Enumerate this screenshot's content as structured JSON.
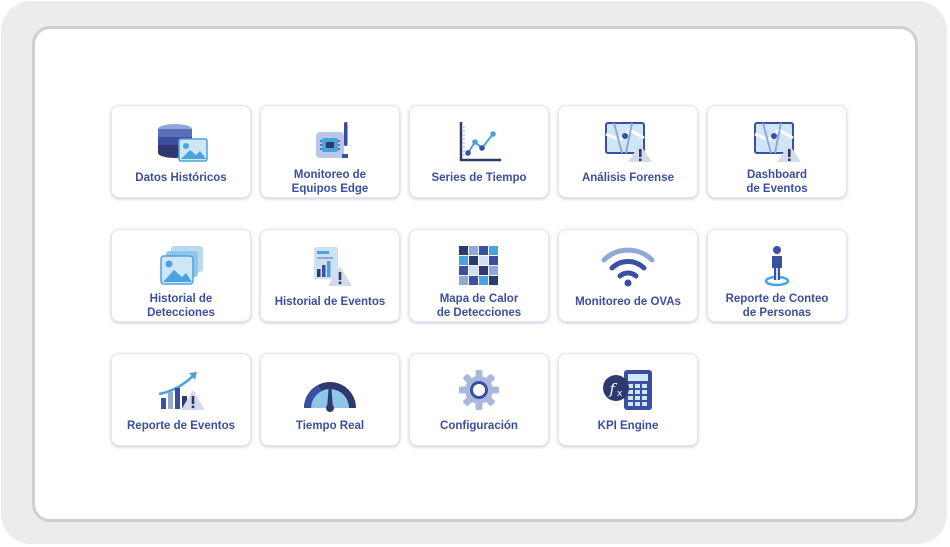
{
  "colors": {
    "primary": "#3b4fa0",
    "accent": "#4aa3df",
    "soft": "#8ea8d8",
    "warning": "#2e3a6e"
  },
  "tiles": [
    {
      "label": "Datos Históricos",
      "icon": "database-image-icon"
    },
    {
      "label": "Monitoreo de\nEquipos Edge",
      "icon": "edge-device-icon"
    },
    {
      "label": "Series de Tiempo",
      "icon": "line-chart-icon"
    },
    {
      "label": "Análisis Forense",
      "icon": "map-alert-icon"
    },
    {
      "label": "Dashboard\nde Eventos",
      "icon": "map-alert-icon"
    },
    {
      "label": "Historial de\nDetecciones",
      "icon": "image-stack-icon"
    },
    {
      "label": "Historial de Eventos",
      "icon": "report-alert-icon"
    },
    {
      "label": "Mapa de Calor\nde Detecciones",
      "icon": "heatmap-icon"
    },
    {
      "label": "Monitoreo de OVAs",
      "icon": "wifi-icon"
    },
    {
      "label": "Reporte de Conteo\nde Personas",
      "icon": "person-location-icon"
    },
    {
      "label": "Reporte de Eventos",
      "icon": "trend-alert-icon"
    },
    {
      "label": "Tiempo Real",
      "icon": "gauge-icon"
    },
    {
      "label": "Configuración",
      "icon": "gear-icon"
    },
    {
      "label": "KPI Engine",
      "icon": "calculator-function-icon"
    }
  ]
}
